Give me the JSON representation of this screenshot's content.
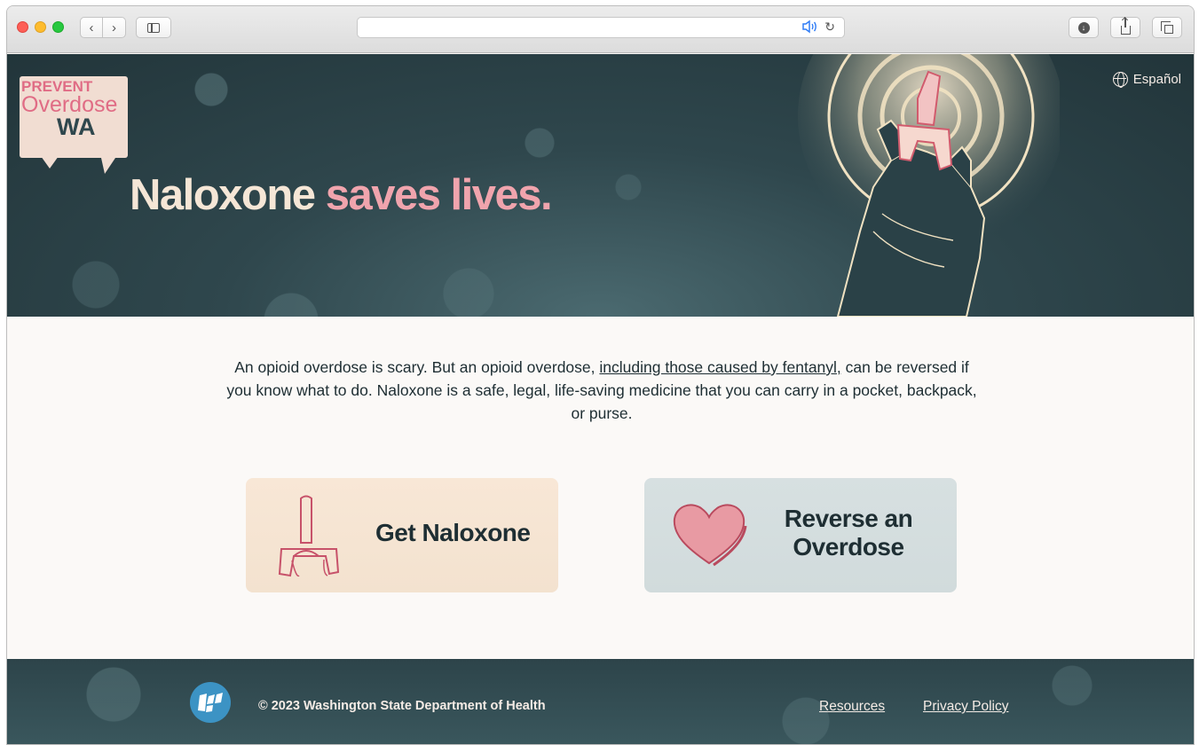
{
  "browser": {
    "icons": {
      "back": "chevron-left-icon",
      "forward": "chevron-right-icon",
      "sidebar": "sidebar-icon",
      "speaker": "speaker-icon",
      "reload": "reload-icon",
      "download": "download-icon",
      "share": "share-icon",
      "tabs": "tabs-icon"
    },
    "glyphs": {
      "back": "‹",
      "forward": "›",
      "speaker": "🔊",
      "reload": "↻",
      "download": "↓"
    }
  },
  "header": {
    "logo": {
      "line1": "PREVENT",
      "line2": "Overdose",
      "line3": "WA"
    },
    "language_link": "Español"
  },
  "hero": {
    "headline_part1": "Naloxone",
    "headline_part2": "saves lives."
  },
  "main": {
    "intro_part1": "An opioid overdose is scary. But an opioid overdose,",
    "intro_link": "including those caused by fentanyl,",
    "intro_part2": "can be reversed if you know what to do. Naloxone is a safe, legal, life-saving medicine that you can carry in a pocket, backpack, or purse.",
    "cards": [
      {
        "label": "Get Naloxone",
        "icon": "nasal-spray-icon",
        "color": "#f6e5d3"
      },
      {
        "label": "Reverse an Overdose",
        "icon": "heart-icon",
        "color": "#d5dfe0"
      }
    ]
  },
  "footer": {
    "copyright": "© 2023 Washington State Department of Health",
    "links": {
      "resources": "Resources",
      "privacy": "Privacy Policy"
    }
  },
  "colors": {
    "hero_bg": "#2f474d",
    "accent_pink": "#f0a4ad",
    "cream": "#f5e6d6",
    "text_dark": "#1e2e33",
    "doh_blue": "#3c93c4"
  }
}
